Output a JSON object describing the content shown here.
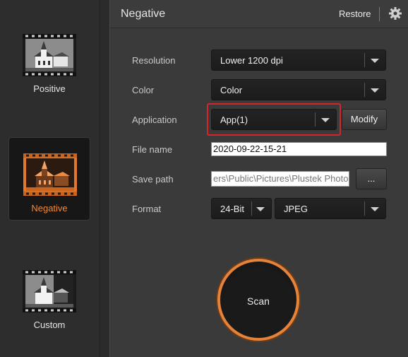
{
  "sidebar": {
    "modes": [
      {
        "label": "Positive",
        "icon": "church-positive-film-icon",
        "active": false
      },
      {
        "label": "Negative",
        "icon": "church-negative-film-icon",
        "active": true
      },
      {
        "label": "Custom",
        "icon": "church-custom-film-icon",
        "active": false
      }
    ]
  },
  "header": {
    "title": "Negative",
    "restore_label": "Restore",
    "settings_icon": "gear-icon"
  },
  "form": {
    "resolution": {
      "label": "Resolution",
      "value": "Lower 1200 dpi"
    },
    "color": {
      "label": "Color",
      "value": "Color"
    },
    "application": {
      "label": "Application",
      "value": "App(1)",
      "modify_label": "Modify"
    },
    "file_name": {
      "label": "File name",
      "value": "2020-09-22-15-21"
    },
    "save_path": {
      "label": "Save path",
      "value": "ers\\Public\\Pictures\\Plustek Photo",
      "browse_label": "..."
    },
    "format": {
      "label": "Format",
      "bit_depth": "24-Bit",
      "file_type": "JPEG"
    }
  },
  "scan_label": "Scan",
  "colors": {
    "accent": "#f08a3c",
    "highlight": "#d6242b"
  }
}
